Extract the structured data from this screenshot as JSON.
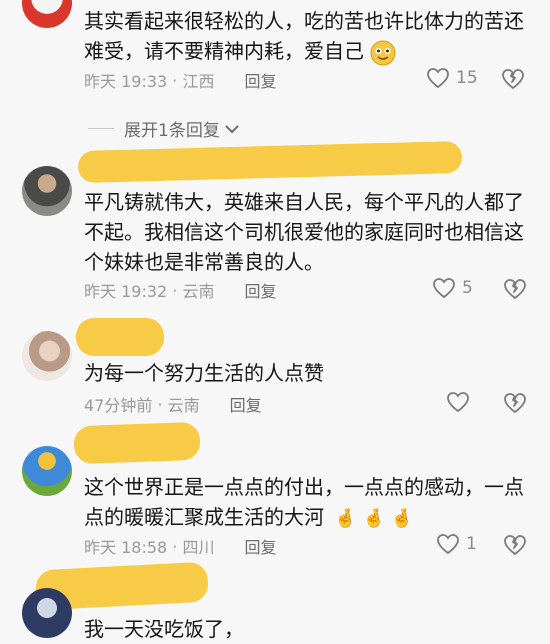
{
  "comments": [
    {
      "text": "其实看起来很轻松的人，吃的苦也许比体力的苦还难受，请不要精神内耗，爱自己",
      "time": "昨天 19:33",
      "location": "江西",
      "reply": "回复",
      "likes": "15"
    },
    {
      "text": "平凡铸就伟大，英雄来自人民，每个平凡的人都了不起。我相信这个司机很爱他的家庭同时也相信这个妹妹也是非常善良的人。",
      "time": "昨天 19:32",
      "location": "云南",
      "reply": "回复",
      "likes": "5"
    },
    {
      "text": "为每一个努力生活的人点赞",
      "time": "47分钟前",
      "location": "云南",
      "reply": "回复",
      "likes": ""
    },
    {
      "text": "这个世界正是一点点的付出，一点点的感动，一点点的暖暖汇聚成生活的大河",
      "time": "昨天 18:58",
      "location": "四川",
      "reply": "回复",
      "likes": "1"
    },
    {
      "text": "我一天没吃饭了，",
      "time": "",
      "location": "",
      "reply": "",
      "likes": ""
    }
  ],
  "expand_replies": "展开1条回复",
  "colors": {
    "highlight": "#f7c83c",
    "meta": "#9a9a9a",
    "background": "#f7f7f7"
  },
  "icons": {
    "like": "heart-outline-icon",
    "dislike": "broken-heart-icon",
    "expand": "chevron-down-icon"
  }
}
